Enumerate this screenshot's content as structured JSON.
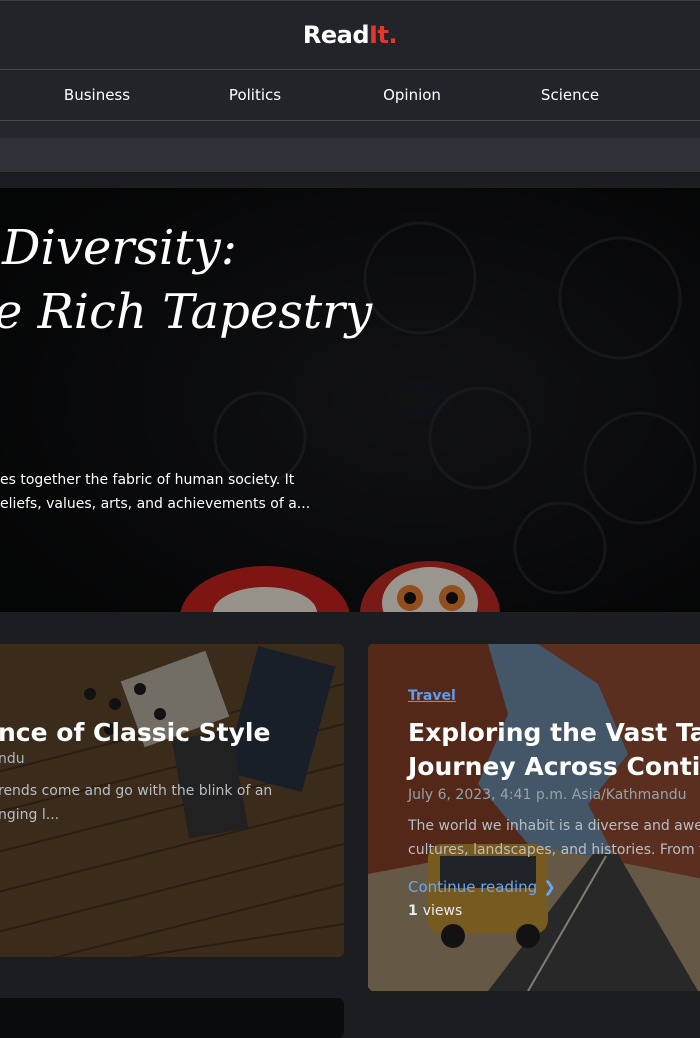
{
  "brand": {
    "name": "Read",
    "accent": "It",
    "dot": "."
  },
  "nav": [
    "Business",
    "Politics",
    "Opinion",
    "Science"
  ],
  "hero": {
    "title_lines": [
      "Diversity:",
      "e Rich Tapestry"
    ],
    "excerpt_lines": [
      "es together the fabric of human society. It",
      "eliefs, values, arts, and achievements of a..."
    ]
  },
  "card1": {
    "title": "nce of Classic Style",
    "meta": "ndu",
    "excerpt_lines": [
      "rends come and go with the blink of an",
      "nging l..."
    ]
  },
  "card2": {
    "category": "Travel",
    "title_lines": [
      "Exploring the Vast Tape",
      "Journey Across Contine"
    ],
    "meta": "July 6, 2023, 4:41 p.m. Asia/Kathmandu",
    "excerpt_lines": [
      "The world we inhabit is a diverse and awe",
      "cultures, landscapes, and histories. From t"
    ],
    "cta": "Continue reading",
    "views_count": "1",
    "views_label": "views"
  },
  "colors": {
    "accent": "#e2372f",
    "link": "#6aa8f7",
    "category": "#5d9cf0",
    "background": "#1b1d21"
  }
}
